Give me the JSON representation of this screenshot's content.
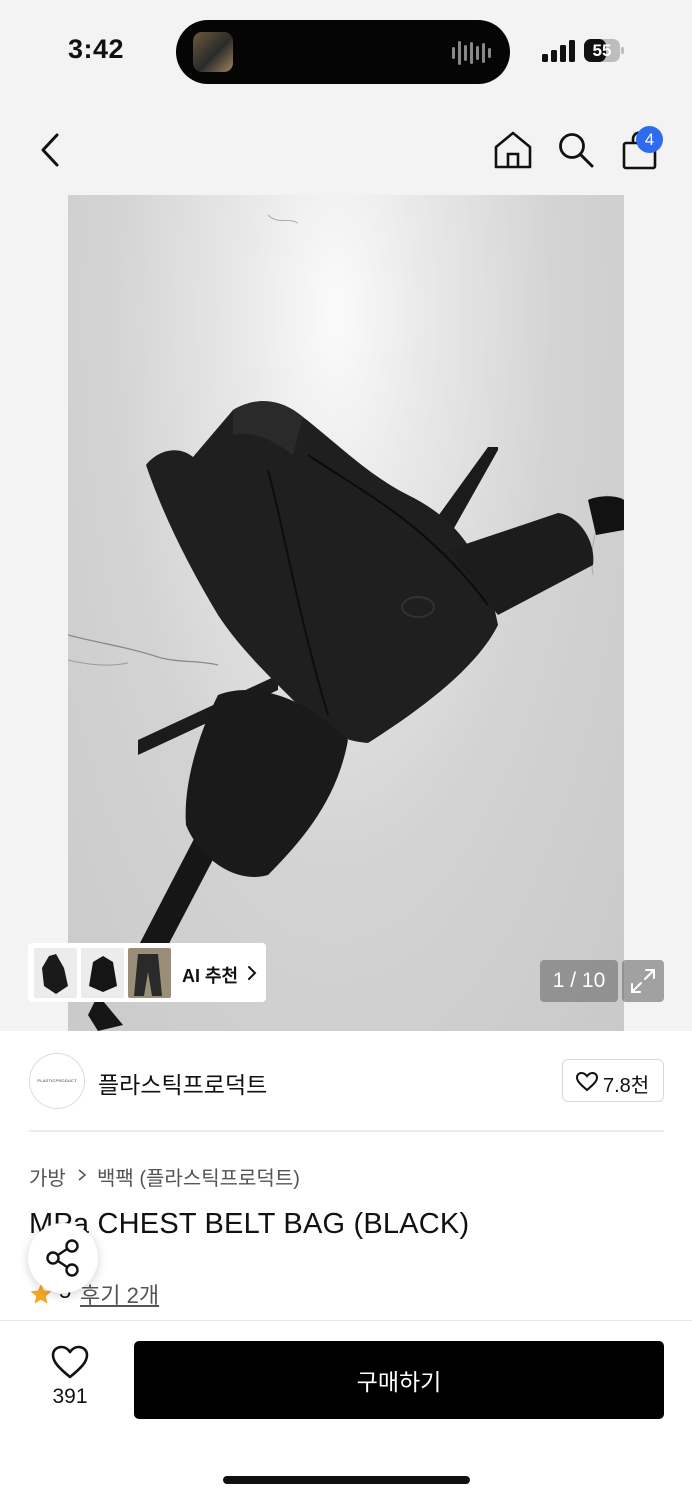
{
  "status_bar": {
    "time": "3:42",
    "battery_level": "55"
  },
  "nav": {
    "cart_count": "4"
  },
  "gallery": {
    "counter": "1 / 10",
    "ai_recommend_label": "AI 추천"
  },
  "brand": {
    "logo_text": "PLASTICPRODUCT",
    "name": "플라스틱프로덕트",
    "like_count": "7.8천"
  },
  "product": {
    "breadcrumb": [
      "가방",
      "백팩 (플라스틱프로덕트)"
    ],
    "title": "MPa CHEST BELT BAG (BLACK)",
    "rating": "5",
    "review_link": "후기 2개"
  },
  "bottom_bar": {
    "wishlist_count": "391",
    "buy_label": "구매하기"
  },
  "colors": {
    "accent_blue": "#2f6bf0",
    "star": "#f5a623",
    "buy_button": "#000000"
  }
}
